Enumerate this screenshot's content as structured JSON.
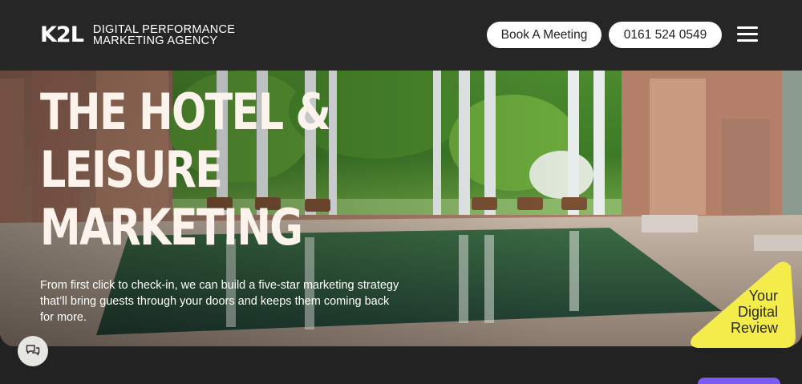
{
  "header": {
    "logo_mark": "K2L",
    "logo_tag_line1": "DIGITAL PERFORMANCE",
    "logo_tag_line2": "MARKETING AGENCY",
    "book_meeting_label": "Book A Meeting",
    "phone_label": "0161 524 0549",
    "menu_icon": "hamburger-menu-icon"
  },
  "hero": {
    "title_line1": "THE HOTEL &",
    "title_line2": "LEISURE",
    "title_line3": "MARKETING",
    "subtitle": "From first click to check-in, we can build a five-star marketing strategy that’ll bring guests through your doors and keeps them coming back for more.",
    "image": "indoor-pool-photo"
  },
  "review_badge": {
    "line1": "Your",
    "line2": "Digital",
    "line3": "Review",
    "color": "#f4ec4a"
  },
  "chat": {
    "icon": "chat-bubbles-icon"
  },
  "colors": {
    "header_bg": "#262626",
    "accent_purple": "#7c5cf0"
  }
}
